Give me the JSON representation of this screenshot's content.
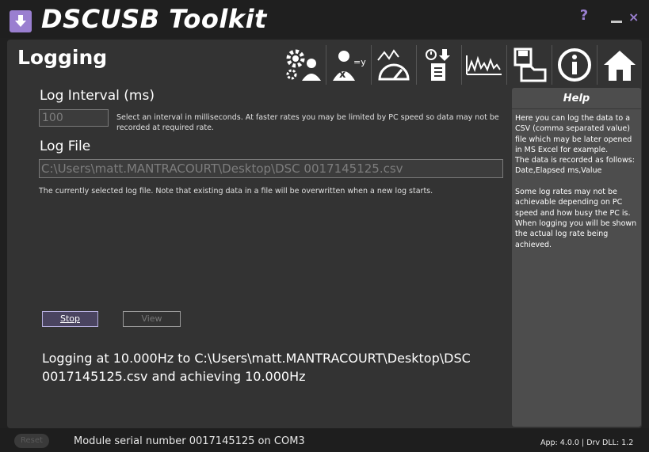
{
  "app": {
    "title": "DSCUSB Toolkit",
    "help_glyph": "?",
    "close_glyph": "×"
  },
  "page": {
    "title": "Logging"
  },
  "toolbar": {
    "icons": [
      "settings-user-icon",
      "math-user-icon",
      "gauge-icon",
      "timer-log-icon",
      "chart-icon",
      "save-folder-icon",
      "info-icon",
      "home-icon"
    ]
  },
  "log_interval": {
    "label": "Log Interval (ms)",
    "value": "100",
    "description": "Select an interval in milliseconds. At faster rates you may be limited by PC speed so data may not be recorded at required rate."
  },
  "log_file": {
    "label": "Log File",
    "value": "C:\\Users\\matt.MANTRACOURT\\Desktop\\DSC 0017145125.csv",
    "description": "The currently selected log file. Note that existing data in a file will be overwritten when a new log starts."
  },
  "buttons": {
    "stop": "Stop",
    "view": "View",
    "reset": "Reset"
  },
  "status": "Logging at 10.000Hz to C:\\Users\\matt.MANTRACOURT\\Desktop\\DSC 0017145125.csv and achieving 10.000Hz",
  "help": {
    "title": "Help",
    "text": "Here you can log the data to a CSV (comma separated value) file which may be later opened in MS Excel for example.\n The data is recorded as follows: Date,Elapsed ms,Value\n\nSome log rates may not be achievable depending on PC speed and how busy the PC is. When logging you will be shown the actual log rate being achieved."
  },
  "footer": {
    "serial": "Module serial number 0017145125 on COM3",
    "version": "App: 4.0.0 | Drv DLL: 1.2"
  },
  "colors": {
    "accent": "#9a7fd0",
    "background": "#333333",
    "help_panel": "#4d4d4d"
  }
}
